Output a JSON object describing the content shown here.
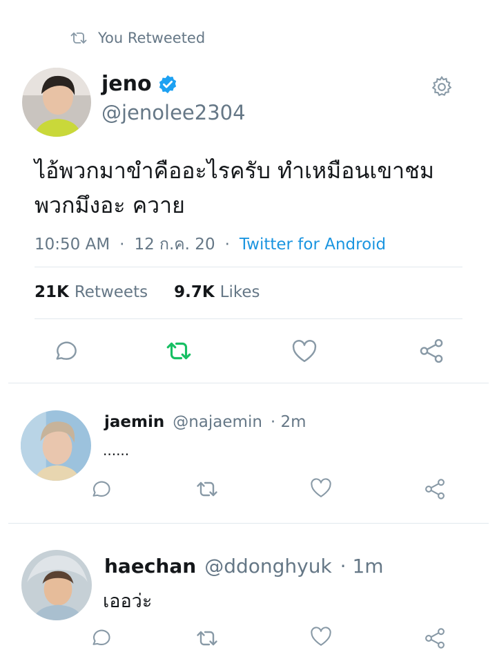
{
  "context": {
    "label": "You Retweeted"
  },
  "tweet": {
    "name": "jeno",
    "handle": "@jenolee2304",
    "text_line1": "ไอ้พวกมาขำคืออะไรครับ ทำเหมือนเขาชม",
    "text_line2": "พวกมึงอะ ควาย",
    "time": "10:50 AM",
    "sep1": "·",
    "date": "12 ก.ค. 20",
    "sep2": "·",
    "source": "Twitter for Android",
    "retweets_count": "21K",
    "retweets_label": "Retweets",
    "likes_count": "9.7K",
    "likes_label": "Likes"
  },
  "replies": [
    {
      "name": "jaemin",
      "handle": "@najaemin",
      "time": "· 2m",
      "text": "......"
    },
    {
      "name": "haechan",
      "handle": "@ddonghyuk",
      "time": "· 1m",
      "text": "เออว่ะ"
    }
  ],
  "colors": {
    "accent": "#1b95e0",
    "retweet_active": "#17bf63",
    "muted": "#657786",
    "divider": "#e1e8ed",
    "verified": "#1da1f2"
  },
  "icons": [
    "retweet-icon",
    "verified-badge-icon",
    "gear-icon",
    "reply-icon",
    "heart-icon",
    "share-icon"
  ]
}
